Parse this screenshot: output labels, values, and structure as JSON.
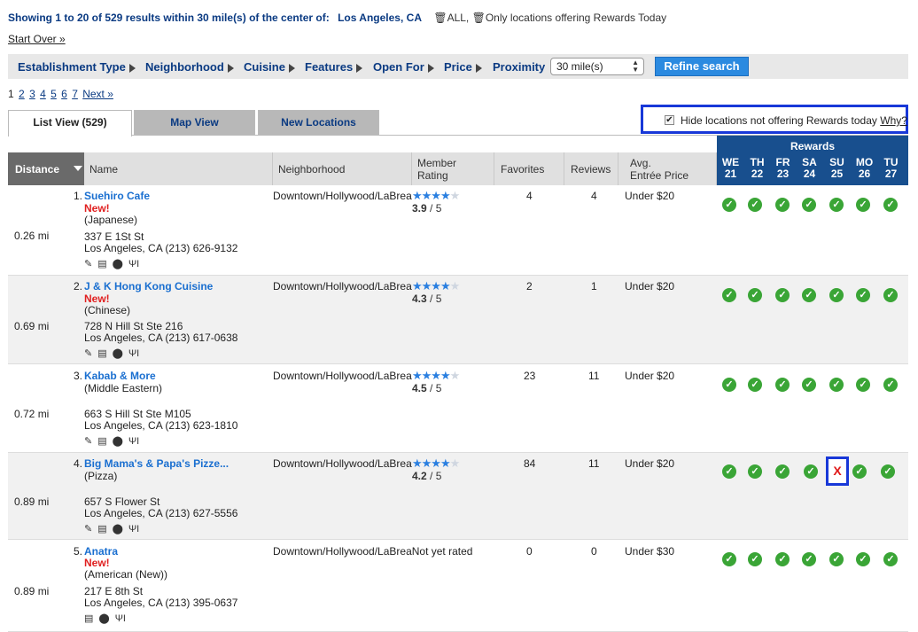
{
  "summary": {
    "results": "Showing 1 to 20 of 529 results within 30 mile(s) of the center of:",
    "location": "Los Angeles, CA",
    "options": "🗑ALL, 🗑Only locations offering Rewards Today"
  },
  "start_over": "Start Over »",
  "filters": {
    "establishment": "Establishment Type",
    "neighborhood": "Neighborhood",
    "cuisine": "Cuisine",
    "features": "Features",
    "open_for": "Open For",
    "price": "Price",
    "proximity": "Proximity",
    "proximity_value": "30 mile(s)",
    "refine": "Refine search"
  },
  "pager": {
    "p1": "1",
    "p2": "2",
    "p3": "3",
    "p4": "4",
    "p5": "5",
    "p6": "6",
    "p7": "7",
    "next": "Next »"
  },
  "tabs": {
    "list": "List View (529)",
    "map": "Map View",
    "new": "New Locations"
  },
  "hide": {
    "label": "Hide locations not offering Rewards today",
    "why": "Why?"
  },
  "columns": {
    "distance": "Distance",
    "name": "Name",
    "neighborhood": "Neighborhood",
    "rating1": "Member",
    "rating2": "Rating",
    "favorites": "Favorites",
    "reviews": "Reviews",
    "price1": "Avg.",
    "price2": "Entrée Price",
    "rewards": "Rewards"
  },
  "days": [
    {
      "d": "WE",
      "n": "21"
    },
    {
      "d": "TH",
      "n": "22"
    },
    {
      "d": "FR",
      "n": "23"
    },
    {
      "d": "SA",
      "n": "24"
    },
    {
      "d": "SU",
      "n": "25"
    },
    {
      "d": "MO",
      "n": "26"
    },
    {
      "d": "TU",
      "n": "27"
    }
  ],
  "rows": [
    {
      "num": "1.",
      "name": "Suehiro Cafe",
      "new": "New!",
      "cuisine": "(Japanese)",
      "addr1": "337 E 1St St",
      "addr2": "Los Angeles, CA (213) 626-9132",
      "distance": "0.26 mi",
      "neighborhood": "Downtown/Hollywood/LaBrea",
      "rating": "3.9",
      "rating_suffix": " / 5",
      "favorites": "4",
      "reviews": "4",
      "price": "Under $20"
    },
    {
      "num": "2.",
      "name": "J & K Hong Kong Cuisine",
      "new": "New!",
      "cuisine": "(Chinese)",
      "addr1": "728 N Hill St Ste 216",
      "addr2": "Los Angeles, CA (213) 617-0638",
      "distance": "0.69 mi",
      "neighborhood": "Downtown/Hollywood/LaBrea",
      "rating": "4.3",
      "rating_suffix": " / 5",
      "favorites": "2",
      "reviews": "1",
      "price": "Under $20"
    },
    {
      "num": "3.",
      "name": "Kabab & More",
      "new": "",
      "cuisine": "(Middle Eastern)",
      "addr1": "663 S Hill St Ste M105",
      "addr2": "Los Angeles, CA (213) 623-1810",
      "distance": "0.72 mi",
      "neighborhood": "Downtown/Hollywood/LaBrea",
      "rating": "4.5",
      "rating_suffix": " / 5",
      "favorites": "23",
      "reviews": "11",
      "price": "Under $20"
    },
    {
      "num": "4.",
      "name": "Big Mama's & Papa's Pizze...",
      "new": "",
      "cuisine": "(Pizza)",
      "addr1": "657 S Flower St",
      "addr2": "Los Angeles, CA (213) 627-5556",
      "distance": "0.89 mi",
      "neighborhood": "Downtown/Hollywood/LaBrea",
      "rating": "4.2",
      "rating_suffix": " / 5",
      "favorites": "84",
      "reviews": "11",
      "price": "Under $20"
    },
    {
      "num": "5.",
      "name": "Anatra",
      "new": "New!",
      "cuisine": "(American (New))",
      "addr1": "217 E 8th St",
      "addr2": "Los Angeles, CA (213) 395-0637",
      "distance": "0.89 mi",
      "neighborhood": "Downtown/Hollywood/LaBreaNot yet rated",
      "rating": "",
      "rating_suffix": "",
      "favorites": "0",
      "reviews": "0",
      "price": "Under $30"
    }
  ],
  "icon_glyphs": {
    "edit": "✎",
    "menu": "▤",
    "pin": "⬤",
    "fork": "ΨΙ"
  },
  "check_glyph": "✓",
  "x_glyph": "X",
  "colors": {
    "accent": "#184f8e",
    "link": "#1a6fd0",
    "check": "#3aa536",
    "highlight": "#1838d8",
    "new": "#e02020"
  }
}
